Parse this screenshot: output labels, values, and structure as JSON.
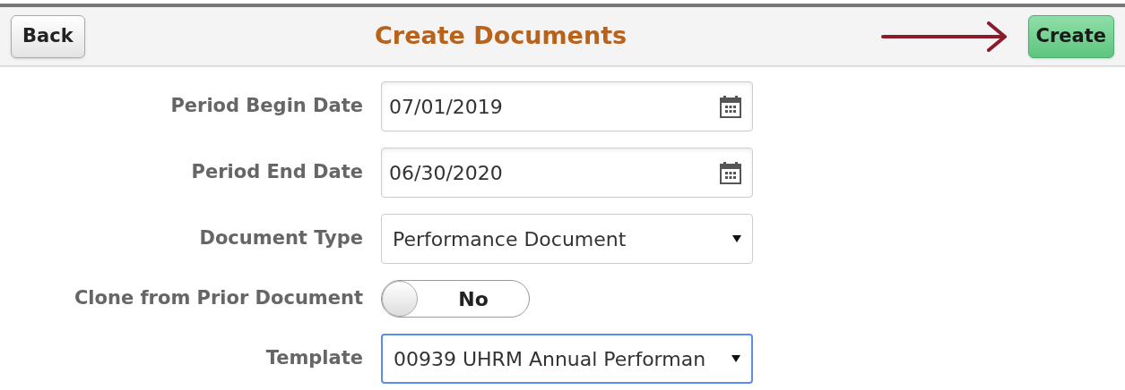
{
  "header": {
    "back_button": "Back",
    "title": "Create Documents",
    "create_button": "Create"
  },
  "fields": [
    {
      "kind": "date",
      "label": "Period Begin Date",
      "value": "07/01/2019",
      "focused": false
    },
    {
      "kind": "date",
      "label": "Period End Date",
      "value": "06/30/2020",
      "focused": false
    },
    {
      "kind": "select",
      "label": "Document Type",
      "value": "Performance Document",
      "focused": false
    },
    {
      "kind": "toggle",
      "label": "Clone from Prior Document",
      "value": "No",
      "on": false
    },
    {
      "kind": "select",
      "label": "Template",
      "value": "00939 UHRM Annual Performan",
      "focused": true
    }
  ]
}
